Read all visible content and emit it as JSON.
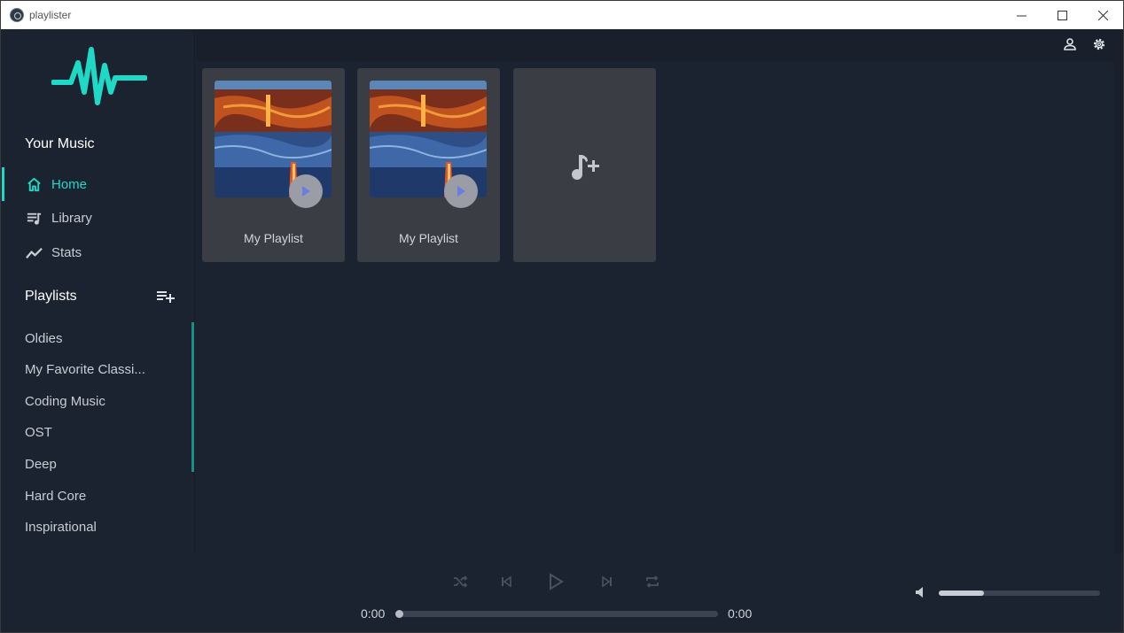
{
  "window": {
    "title": "playlister",
    "colors": {
      "accent": "#1fd9c7",
      "background": "#1c2330",
      "card": "#3a3d44"
    }
  },
  "sidebar": {
    "your_music_title": "Your Music",
    "nav": [
      {
        "label": "Home",
        "icon": "home-icon",
        "active": true
      },
      {
        "label": "Library",
        "icon": "library-icon",
        "active": false
      },
      {
        "label": "Stats",
        "icon": "stats-icon",
        "active": false
      }
    ],
    "playlists_title": "Playlists",
    "playlists": [
      "Oldies",
      "My Favorite Classi...",
      "Coding Music",
      "OST",
      "Deep",
      "Hard Core",
      "Inspirational"
    ]
  },
  "main": {
    "cards": [
      {
        "label": "My Playlist"
      },
      {
        "label": "My Playlist"
      }
    ]
  },
  "player": {
    "current_time": "0:00",
    "total_time": "0:00",
    "progress": 0,
    "volume": 0.28
  }
}
